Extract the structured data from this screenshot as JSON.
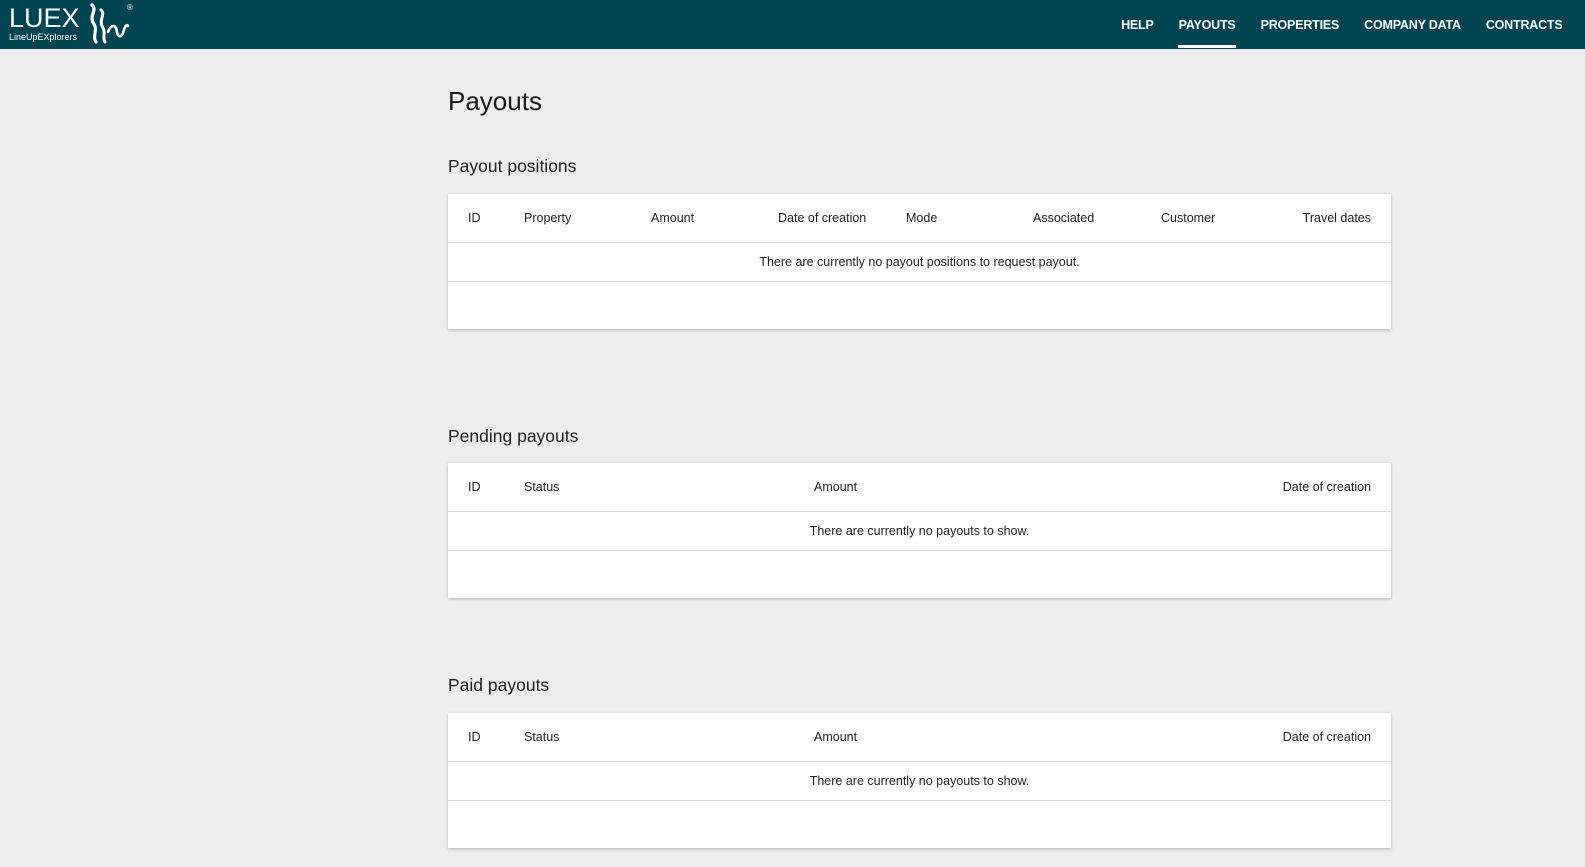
{
  "brand": {
    "name": "LUEX",
    "tagline": "LineUpEXplorers",
    "registered": "®"
  },
  "nav": {
    "items": [
      {
        "label": "HELP",
        "active": false
      },
      {
        "label": "PAYOUTS",
        "active": true
      },
      {
        "label": "PROPERTIES",
        "active": false
      },
      {
        "label": "COMPANY DATA",
        "active": false
      },
      {
        "label": "CONTRACTS",
        "active": false
      }
    ]
  },
  "page": {
    "title": "Payouts"
  },
  "sections": {
    "positions": {
      "title": "Payout positions",
      "columns": [
        "ID",
        "Property",
        "Amount",
        "Date of creation",
        "Mode",
        "Associated",
        "Customer",
        "Travel dates"
      ],
      "empty_message": "There are currently no payout positions to request payout."
    },
    "pending": {
      "title": "Pending payouts",
      "columns": [
        "ID",
        "Status",
        "Amount",
        "Date of creation"
      ],
      "empty_message": "There are currently no payouts to show."
    },
    "paid": {
      "title": "Paid payouts",
      "columns": [
        "ID",
        "Status",
        "Amount",
        "Date of creation"
      ],
      "empty_message": "There are currently no payouts to show."
    }
  },
  "colors": {
    "header_bg": "#004451",
    "page_bg": "#ededed"
  }
}
